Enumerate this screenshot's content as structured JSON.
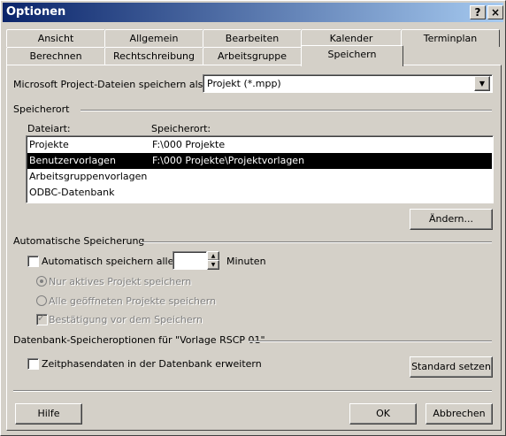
{
  "window": {
    "title": "Optionen",
    "help_btn": "?",
    "close_btn": "×"
  },
  "tabs_row1": [
    {
      "label": "Ansicht"
    },
    {
      "label": "Allgemein"
    },
    {
      "label": "Bearbeiten"
    },
    {
      "label": "Kalender"
    },
    {
      "label": "Terminplan"
    }
  ],
  "tabs_row2": [
    {
      "label": "Berechnen"
    },
    {
      "label": "Rechtschreibung"
    },
    {
      "label": "Arbeitsgruppe"
    },
    {
      "label": "Speichern"
    }
  ],
  "save_as": {
    "label": "Microsoft Project-Dateien speichern als:",
    "value": "Projekt (*.mpp)"
  },
  "location": {
    "group_label": "Speicherort",
    "col_type": "Dateiart:",
    "col_loc": "Speicherort:",
    "rows": [
      {
        "type": "Projekte",
        "loc": "F:\\000 Projekte"
      },
      {
        "type": "Benutzervorlagen",
        "loc": "F:\\000 Projekte\\Projektvorlagen"
      },
      {
        "type": "Arbeitsgruppenvorlagen",
        "loc": ""
      },
      {
        "type": "ODBC-Datenbank",
        "loc": ""
      }
    ],
    "change_btn": "Ändern..."
  },
  "autosave": {
    "group_label": "Automatische Speicherung",
    "check_label": "Automatisch speichern alle:",
    "minutes_value": "",
    "minutes_label": "Minuten",
    "opt_active": "Nur aktives Projekt speichern",
    "opt_all": "Alle geöffneten Projekte speichern",
    "confirm": "Bestätigung vor dem Speichern"
  },
  "db": {
    "group_label": "Datenbank-Speicheroptionen für \"Vorlage RSCP 01\"",
    "check_label": "Zeitphasendaten in der Datenbank erweitern",
    "default_btn": "Standard setzen"
  },
  "footer": {
    "help": "Hilfe",
    "ok": "OK",
    "cancel": "Abbrechen"
  }
}
